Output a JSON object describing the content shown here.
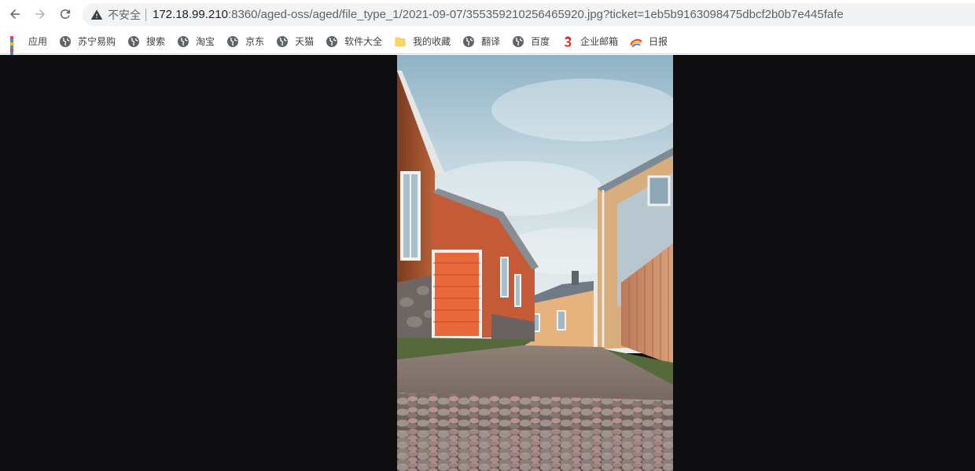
{
  "browser": {
    "address": {
      "security_label": "不安全",
      "host": "172.18.99.210",
      "rest": ":8360/aged-oss/aged/file_type_1/2021-09-07/355359210256465920.jpg?ticket=1eb5b9163098475dbcf2b0b7e445fafe"
    },
    "bookmarks": [
      {
        "label": "应用",
        "icon": "apps-grid-icon"
      },
      {
        "label": "苏宁易购",
        "icon": "globe-icon"
      },
      {
        "label": "搜索",
        "icon": "globe-icon"
      },
      {
        "label": "淘宝",
        "icon": "globe-icon"
      },
      {
        "label": "京东",
        "icon": "globe-icon"
      },
      {
        "label": "天猫",
        "icon": "globe-icon"
      },
      {
        "label": "软件大全",
        "icon": "globe-icon"
      },
      {
        "label": "我的收藏",
        "icon": "folder-icon"
      },
      {
        "label": "翻译",
        "icon": "globe-icon"
      },
      {
        "label": "百度",
        "icon": "globe-icon"
      },
      {
        "label": "企业邮箱",
        "icon": "mail-logo-icon"
      },
      {
        "label": "日报",
        "icon": "rainbow-logo-icon"
      }
    ]
  },
  "viewer": {
    "image_subject": "cobblestone-street-wooden-houses-photo",
    "background_color": "#0e0e10"
  },
  "colors": {
    "omnibox_bg": "#f1f3f4",
    "folder": "#fdd663"
  }
}
